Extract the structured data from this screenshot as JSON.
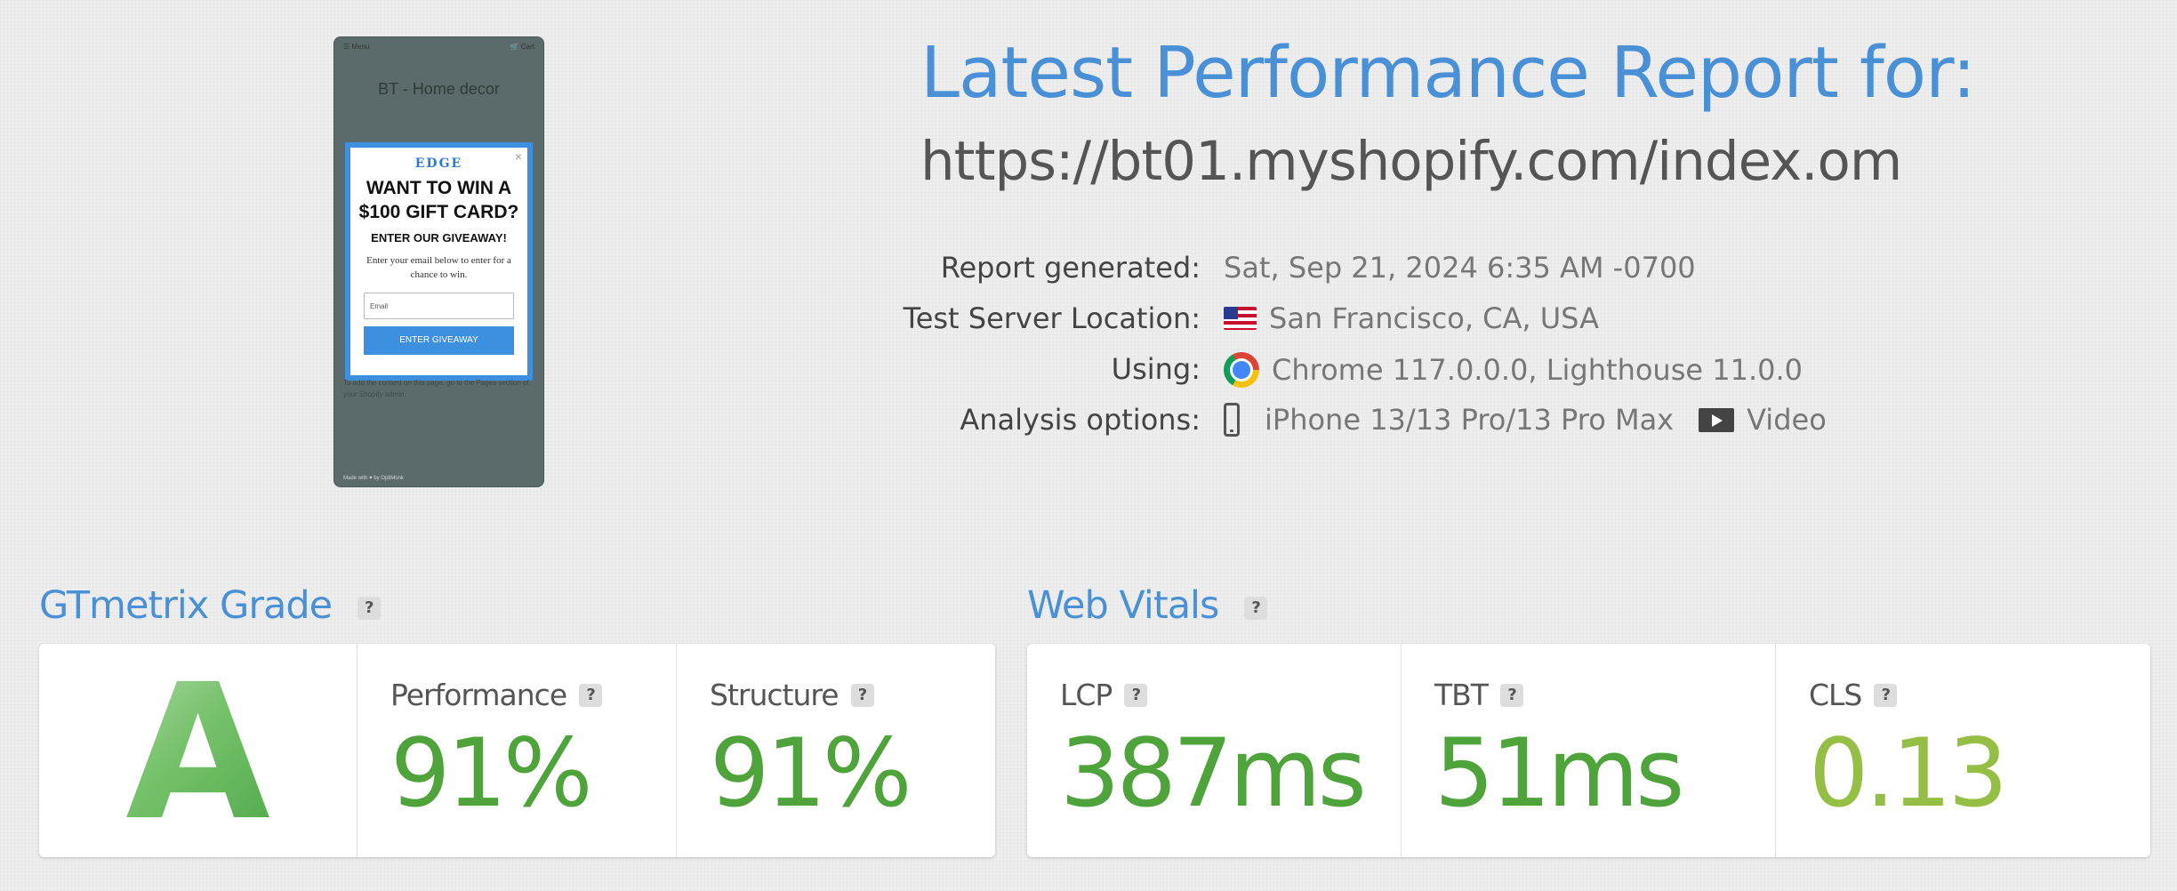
{
  "screenshot": {
    "menu_label": "Menu",
    "cart_label": "Cart",
    "store_name": "BT - Home decor",
    "body_text": "To add the content on this page, go to the Pages section of your Shopify admin.",
    "footer_text": "Made with ♥ by OptiMonk",
    "popup": {
      "brand": "EDGE",
      "headline": "WANT TO WIN A $100 GIFT CARD?",
      "subheadline": "ENTER OUR GIVEAWAY!",
      "text": "Enter your email below to enter for a chance to win.",
      "email_placeholder": "Email",
      "button_label": "ENTER GIVEAWAY",
      "close_label": "×"
    }
  },
  "report": {
    "title": "Latest Performance Report for:",
    "url": "https://bt01.myshopify.com/index.om",
    "rows": [
      {
        "label": "Report generated:",
        "value": "Sat, Sep 21, 2024 6:35 AM -0700"
      },
      {
        "label": "Test Server Location:",
        "value": "San Francisco, CA, USA",
        "icon": "us-flag-icon"
      },
      {
        "label": "Using:",
        "value": "Chrome 117.0.0.0, Lighthouse 11.0.0",
        "icon": "chrome-icon"
      },
      {
        "label": "Analysis options:",
        "value": "iPhone 13/13 Pro/13 Pro Max",
        "icon": "mobile-phone-icon",
        "extra_value": "Video",
        "extra_icon": "video-icon"
      }
    ]
  },
  "gtmetrix": {
    "title": "GTmetrix Grade",
    "help": "?",
    "grade": "A",
    "metrics": [
      {
        "label": "Performance",
        "value": "91%",
        "color": "#4ea33a"
      },
      {
        "label": "Structure",
        "value": "91%",
        "color": "#4ea33a"
      }
    ]
  },
  "web_vitals": {
    "title": "Web Vitals",
    "help": "?",
    "metrics": [
      {
        "label": "LCP",
        "value": "387ms",
        "color": "#4ea33a"
      },
      {
        "label": "TBT",
        "value": "51ms",
        "color": "#4ea33a"
      },
      {
        "label": "CLS",
        "value": "0.13",
        "color": "#95be45"
      }
    ]
  },
  "colors": {
    "accent": "#4a90d6",
    "good": "#4ea33a",
    "ok": "#95be45",
    "popup_blue": "#3d8fe0"
  }
}
